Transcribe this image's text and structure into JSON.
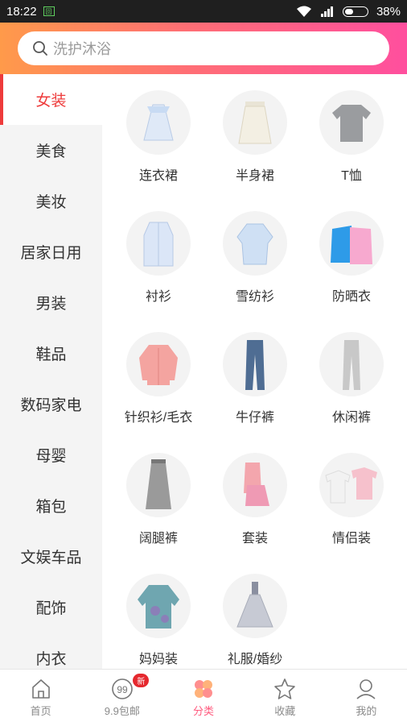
{
  "status": {
    "time": "18:22",
    "sim": "回",
    "battery": "38%",
    "battery_level": 0.38
  },
  "search": {
    "placeholder": "洗护沐浴"
  },
  "sidebar": {
    "items": [
      {
        "label": "女装",
        "active": true
      },
      {
        "label": "美食"
      },
      {
        "label": "美妆"
      },
      {
        "label": "居家日用"
      },
      {
        "label": "男装"
      },
      {
        "label": "鞋品"
      },
      {
        "label": "数码家电"
      },
      {
        "label": "母婴"
      },
      {
        "label": "箱包"
      },
      {
        "label": "文娱车品"
      },
      {
        "label": "配饰"
      },
      {
        "label": "内衣"
      }
    ]
  },
  "categories": [
    {
      "label": "连衣裙",
      "icon": "dress-icon"
    },
    {
      "label": "半身裙",
      "icon": "skirt-icon"
    },
    {
      "label": "T恤",
      "icon": "tshirt-icon"
    },
    {
      "label": "衬衫",
      "icon": "shirt-icon"
    },
    {
      "label": "雪纺衫",
      "icon": "chiffon-blouse-icon"
    },
    {
      "label": "防晒衣",
      "icon": "sun-protection-jacket-icon"
    },
    {
      "label": "针织衫/毛衣",
      "icon": "cardigan-icon"
    },
    {
      "label": "牛仔裤",
      "icon": "jeans-icon"
    },
    {
      "label": "休闲裤",
      "icon": "casual-pants-icon"
    },
    {
      "label": "阔腿裤",
      "icon": "wide-leg-pants-icon"
    },
    {
      "label": "套装",
      "icon": "outfit-set-icon"
    },
    {
      "label": "情侣装",
      "icon": "couple-tshirts-icon"
    },
    {
      "label": "妈妈装",
      "icon": "mom-top-icon"
    },
    {
      "label": "礼服/婚纱",
      "icon": "gown-icon"
    }
  ],
  "tabbar": {
    "items": [
      {
        "label": "首页",
        "icon": "home-icon"
      },
      {
        "label": "9.9包邮",
        "icon": "99-shipping-icon",
        "badge": "新"
      },
      {
        "label": "分类",
        "icon": "category-icon",
        "active": true
      },
      {
        "label": "收藏",
        "icon": "star-icon"
      },
      {
        "label": "我的",
        "icon": "profile-icon"
      }
    ]
  },
  "colors": {
    "accent": "#ee3b3b",
    "header_start": "#ff9a4a",
    "header_end": "#ff4f9e",
    "tab_active": "#ff5b7f"
  }
}
